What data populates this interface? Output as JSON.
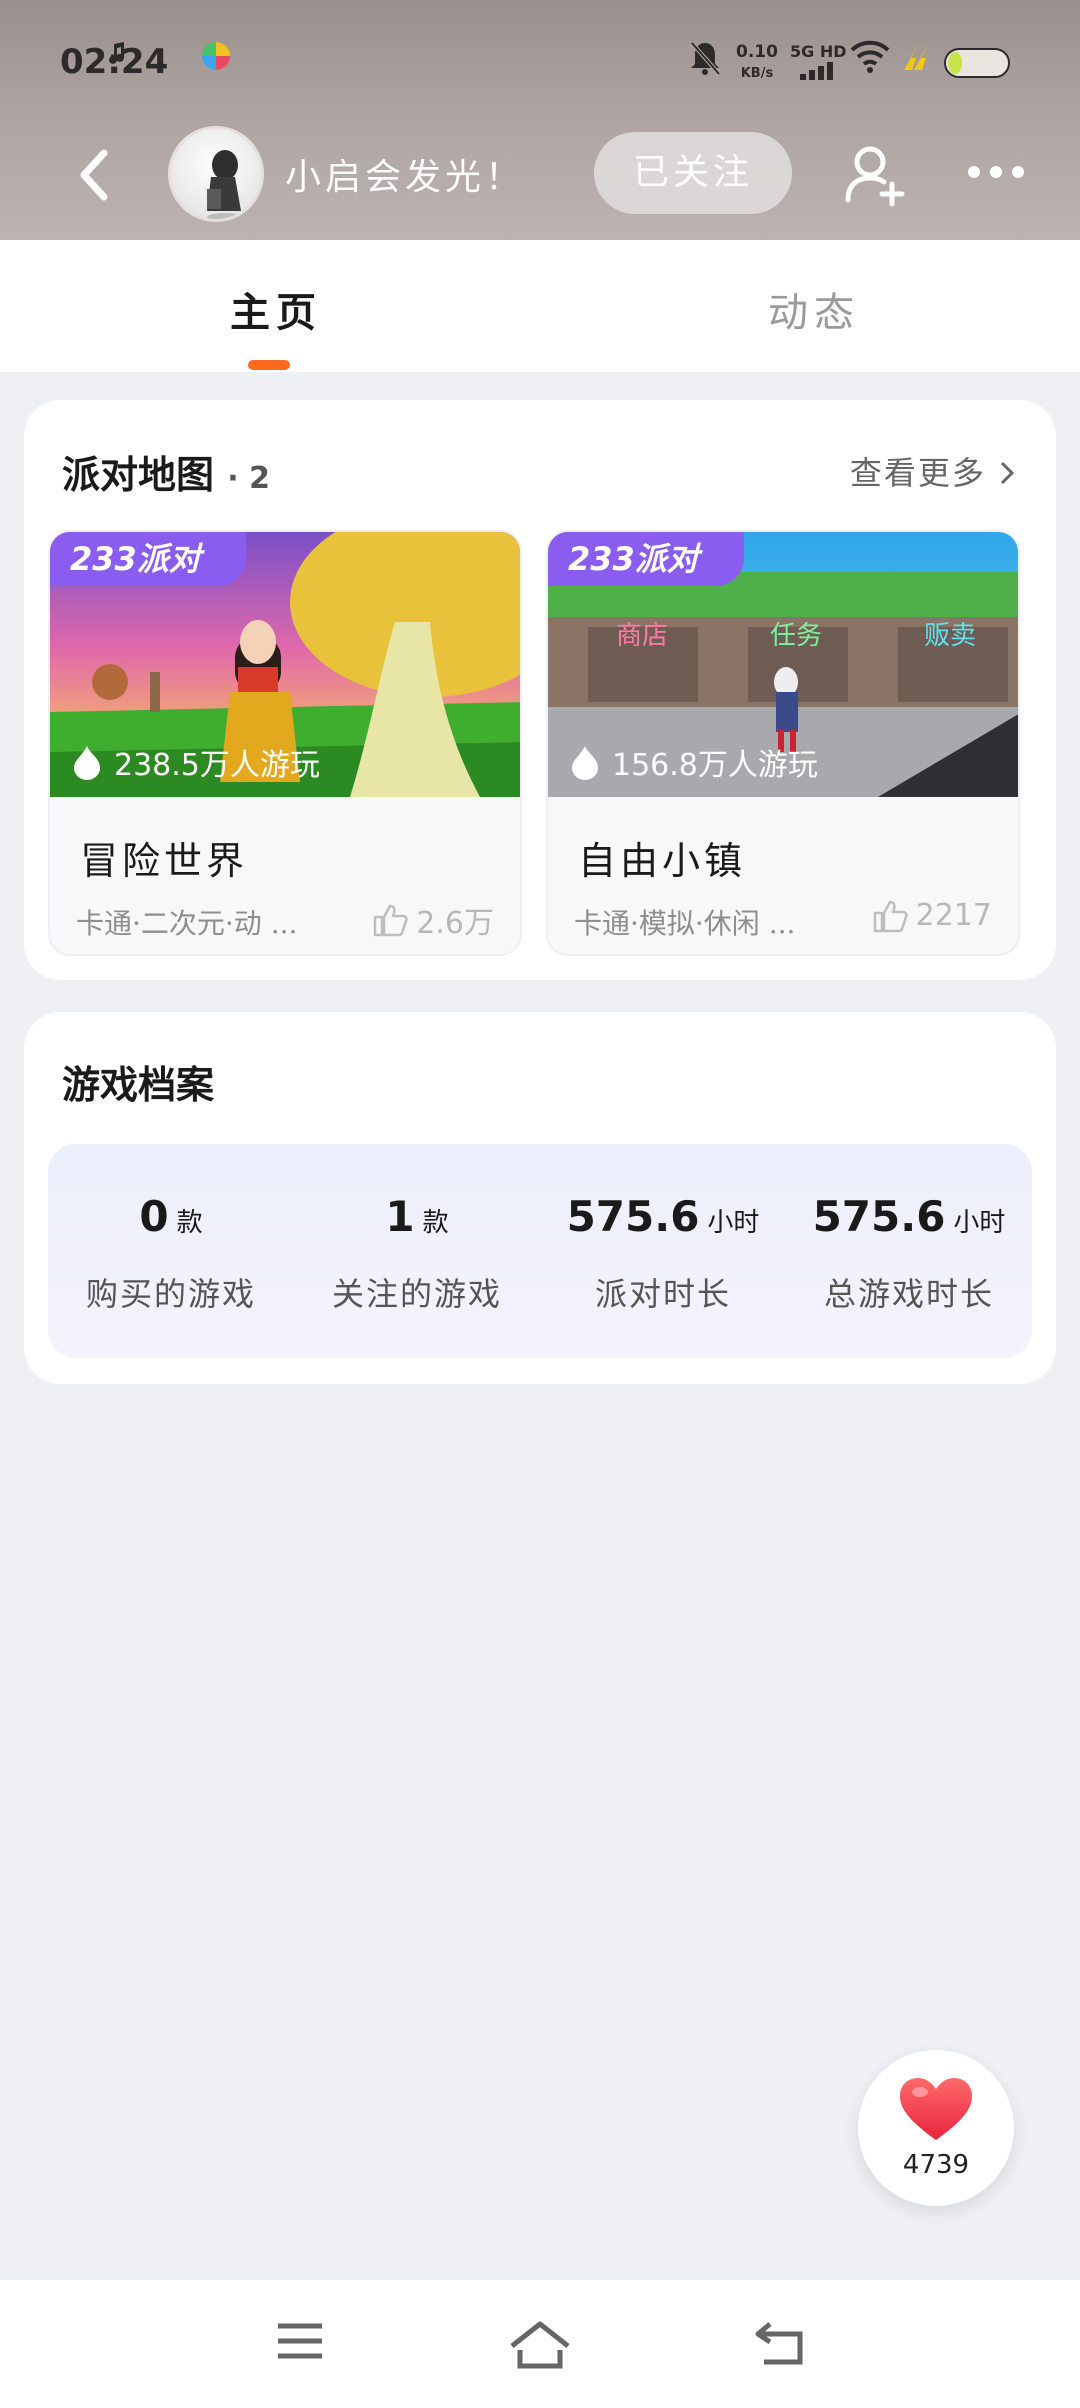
{
  "status_bar": {
    "time": "02:24",
    "net_speed": "0.10",
    "net_speed_unit": "KB/s",
    "network": "5G HD"
  },
  "header": {
    "username": "小启会发光！",
    "follow_label": "已关注"
  },
  "tabs": [
    {
      "label": "主页",
      "active": true
    },
    {
      "label": "动态",
      "active": false
    }
  ],
  "party_maps": {
    "title": "派对地图",
    "count": "· 2",
    "see_more": "查看更多",
    "games": [
      {
        "badge": "233派对",
        "plays": "238.5万人游玩",
        "name": "冒险世界",
        "tags": "卡通·二次元·动 ...",
        "likes": "2.6万"
      },
      {
        "badge": "233派对",
        "plays": "156.8万人游玩",
        "name": "自由小镇",
        "tags": "卡通·模拟·休闲 ...",
        "likes": "2217",
        "signs": [
          "商店",
          "任务",
          "贩卖"
        ]
      }
    ]
  },
  "game_archive": {
    "title": "游戏档案",
    "stats": [
      {
        "value": "0",
        "unit": "款",
        "label": "购买的游戏"
      },
      {
        "value": "1",
        "unit": "款",
        "label": "关注的游戏"
      },
      {
        "value": "575.6",
        "unit": "小时",
        "label": "派对时长"
      },
      {
        "value": "575.6",
        "unit": "小时",
        "label": "总游戏时长"
      }
    ]
  },
  "like_fab": {
    "count": "4739"
  },
  "colors": {
    "accent": "#ff6a1f",
    "badge": "#8a5cf0",
    "heart": "#f0374a"
  }
}
